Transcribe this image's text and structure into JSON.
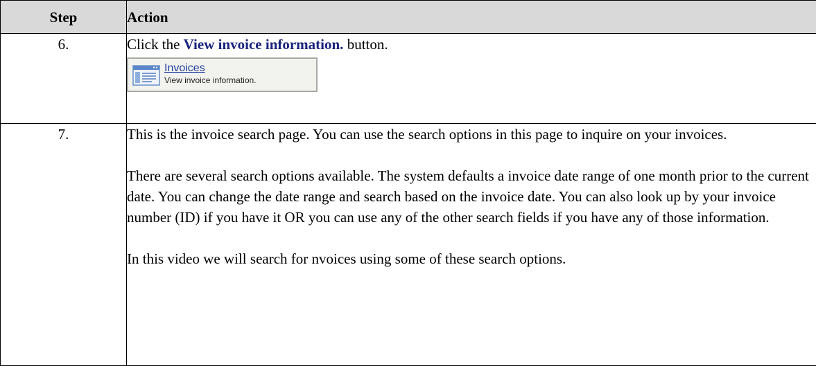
{
  "table": {
    "headers": {
      "step": "Step",
      "action": "Action"
    },
    "rows": [
      {
        "step": "6.",
        "action_prefix": "Click the ",
        "action_button_name": "View invoice information.",
        "action_suffix": " button.",
        "screenshot": {
          "title": "Invoices",
          "description": "View invoice information.",
          "icon": "document-list-icon"
        }
      },
      {
        "step": "7.",
        "paragraphs": [
          "This is the invoice search page. You can use the search options in this page to inquire on your invoices.",
          "There are several search options available. The system defaults a invoice date range of one month prior to the current date. You can change the date range and search based on the invoice date. You can also look up by your invoice number (ID) if you have it OR you can use any of the other search fields if you have any of those information.",
          "In this video we will search for nvoices using some of these search options."
        ]
      }
    ]
  },
  "colors": {
    "header_bg": "#d9d9d9",
    "button_name": "#1a237e",
    "link": "#1f3f9f",
    "screenshot_bg": "#f2f2ee"
  }
}
